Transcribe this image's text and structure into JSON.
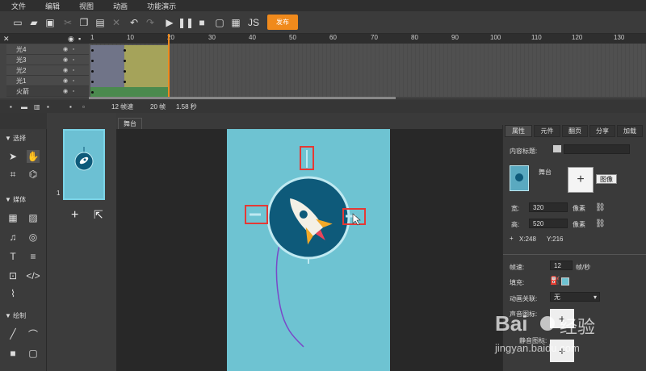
{
  "menu": [
    "文件",
    "编辑",
    "视图",
    "动画",
    "功能演示"
  ],
  "toolbar": {
    "publish_label": "发布"
  },
  "timeline": {
    "ticks": [
      "1",
      "10",
      "20",
      "30",
      "40",
      "50",
      "60",
      "70",
      "80",
      "90",
      "100",
      "110",
      "120",
      "130"
    ],
    "layers": [
      {
        "name": "光4",
        "color": "#6f7486"
      },
      {
        "name": "光3",
        "color": "#6f7486"
      },
      {
        "name": "光2",
        "color": "#6f7486"
      },
      {
        "name": "光1",
        "color": "#6f7486"
      },
      {
        "name": "火箭",
        "color": "#4b8a4e"
      }
    ],
    "fps": "12 帧速",
    "frames": "20 帧",
    "duration": "1.58 秒"
  },
  "tools": {
    "select_header": "选择",
    "media_header": "媒体",
    "draw_header": "绘制"
  },
  "pages": {
    "page_number": "1"
  },
  "stage": {
    "tab_label": "舞台"
  },
  "panel": {
    "tabs": [
      "属性",
      "元件",
      "翻页",
      "分享",
      "加载"
    ],
    "content_title_label": "内容标题:",
    "stage_label": "舞台",
    "image_button": "图像",
    "width_label": "宽:",
    "width_value": "320",
    "height_label": "高:",
    "height_value": "520",
    "px_unit": "像素",
    "x_coord": "X:248",
    "y_coord": "Y:216",
    "framerate_label": "帧速:",
    "framerate_value": "12",
    "framerate_unit": "帧/秒",
    "fill_label": "填充:",
    "anim_link_label": "动画关联:",
    "anim_link_value": "无",
    "sound_icon_label": "声音图标:",
    "mute_icon_label": "静音图标:"
  },
  "watermark": {
    "text1": "Bai",
    "text2": "经验",
    "url": "jingyan.baidu.com"
  },
  "colors": {
    "accent": "#f08a1c",
    "stage": "#6ec3d2",
    "badge": "#0e5a7a",
    "highlight": "#e53935"
  }
}
